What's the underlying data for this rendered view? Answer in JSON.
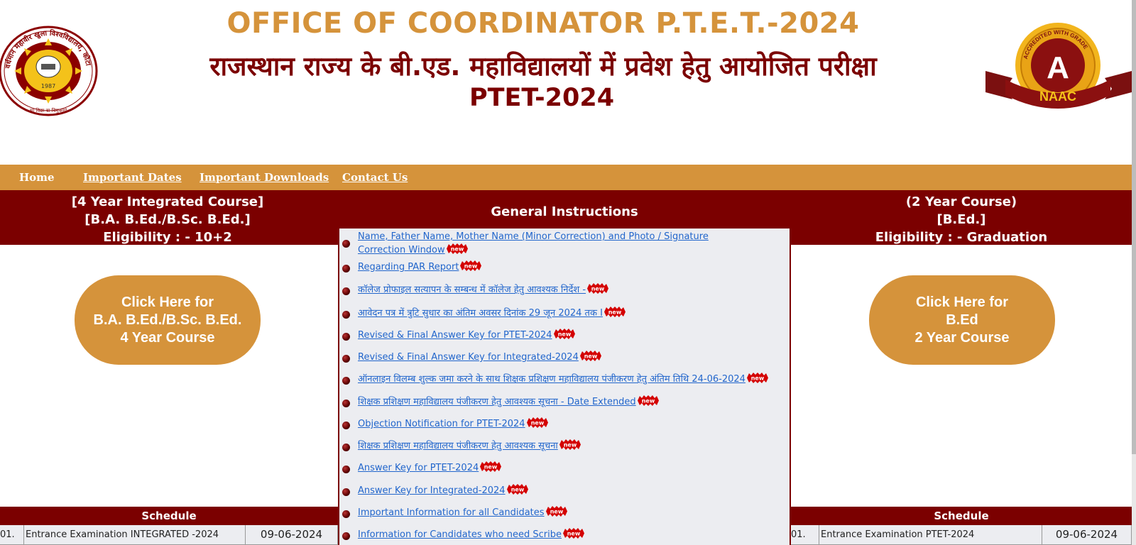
{
  "header": {
    "title_en": "OFFICE OF COORDINATOR P.T.E.T.-2024",
    "title_hi": "राजस्थान राज्य के बी.एड. महाविद्यालयों में प्रवेश हेतु आयोजित परीक्षा",
    "title_ptet": "PTET-2024",
    "left_logo": {
      "icon": "university-seal-icon",
      "year": "1987",
      "ring_text": "वर्धमान महावीर खुला विश्वविद्यालय, कोटा",
      "motto": "सा विद्या या विमुक्तये"
    },
    "right_logo": {
      "icon": "naac-badge-icon",
      "grade": "A",
      "label": "NAAC",
      "ring_text": "ACCREDITED WITH GRADE"
    }
  },
  "nav": {
    "items": [
      "Home",
      "Important Dates",
      "Important Downloads",
      "Contact Us"
    ]
  },
  "band": {
    "left": [
      "[4 Year Integrated Course]",
      "[B.A. B.Ed./B.Sc. B.Ed.]",
      "Eligibility : - 10+2"
    ],
    "center": "General Instructions",
    "right": [
      "(2 Year Course)",
      "[B.Ed.]",
      "Eligibility : - Graduation"
    ]
  },
  "course_buttons": {
    "left": [
      "Click Here for",
      "B.A. B.Ed./B.Sc. B.Ed.",
      "4 Year Course"
    ],
    "right": [
      "Click Here for",
      "B.Ed",
      "2 Year Course"
    ]
  },
  "instructions": {
    "badge_text": "new",
    "items": [
      "Name, Father Name, Mother Name (Minor Correction) and Photo / Signature Correction Window",
      "Regarding PAR Report",
      "कॉलेज प्रोफाइल सत्यापन के सम्बन्ध में कॉलेज हेतु आवश्यक निर्देश -",
      "आवेदन पत्र में त्रुटि सुधार का अंतिम अवसर दिनांक 29 जून 2024 तक I",
      "Revised & Final Answer Key for PTET-2024",
      "Revised & Final Answer Key for Integrated-2024",
      "ऑनलाइन विलम्ब शुल्क जमा करने के साथ शिक्षक प्रशिक्षण महाविद्यालय पंजीकरण हेतु अंतिम तिथि 24-06-2024",
      "शिक्षक प्रशिक्षण महाविद्यालय पंजीकरण हेतु आवश्यक सूचना - Date Extended",
      "Objection Notification for PTET-2024",
      "शिक्षक प्रशिक्षण महाविद्यालय पंजीकरण हेतु आवश्यक सूचना",
      "Answer Key for PTET-2024",
      "Answer Key for Integrated-2024",
      "Important Information for all Candidates",
      "Information for Candidates who need Scribe"
    ]
  },
  "schedule": {
    "heading": "Schedule",
    "left_row": {
      "sno": "01.",
      "event": "Entrance Examination INTEGRATED -2024",
      "date": "09-06-2024"
    },
    "right_row": {
      "sno": "01.",
      "event": "Entrance Examination PTET-2024",
      "date": "09-06-2024"
    }
  },
  "colors": {
    "gold": "#d5933b",
    "maroon": "#7b0000",
    "link": "#2266cc",
    "panel": "#ecedf1"
  }
}
